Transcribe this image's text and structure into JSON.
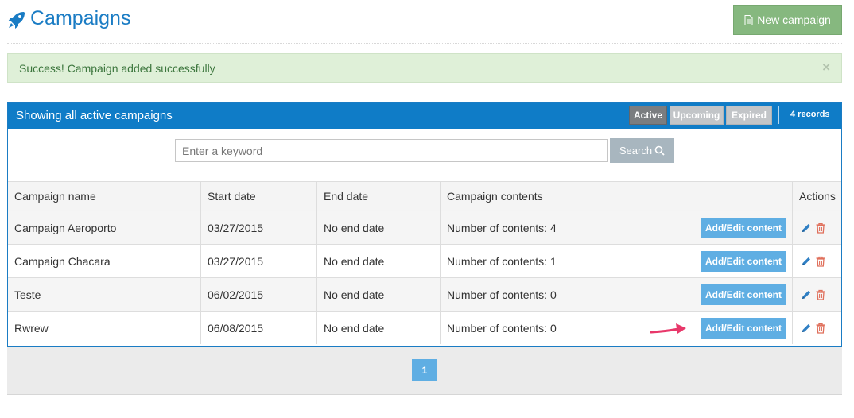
{
  "header": {
    "title": "Campaigns",
    "new_button_label": "New campaign"
  },
  "alert": {
    "message": "Success! Campaign added successfully",
    "close_symbol": "×"
  },
  "panel": {
    "title": "Showing all active campaigns",
    "filters": [
      "Active",
      "Upcoming",
      "Expired"
    ],
    "active_filter": "Active",
    "records": "4 records"
  },
  "search": {
    "placeholder": "Enter a keyword",
    "value": "",
    "button_label": "Search"
  },
  "table": {
    "columns": [
      "Campaign name",
      "Start date",
      "End date",
      "Campaign contents",
      "Actions"
    ],
    "add_button_label": "Add/Edit content",
    "rows": [
      {
        "name": "Campaign Aeroporto",
        "start": "03/27/2015",
        "end": "No end date",
        "contents": "Number of contents: 4"
      },
      {
        "name": "Campaign Chacara",
        "start": "03/27/2015",
        "end": "No end date",
        "contents": "Number of contents: 1"
      },
      {
        "name": "Teste",
        "start": "06/02/2015",
        "end": "No end date",
        "contents": "Number of contents: 0"
      },
      {
        "name": "Rwrew",
        "start": "06/08/2015",
        "end": "No end date",
        "contents": "Number of contents: 0"
      }
    ]
  },
  "pagination": {
    "current_page": "1"
  },
  "icons": {
    "title": "rocket-icon",
    "new_button": "document-icon",
    "search_button": "search-icon",
    "edit": "pencil-icon",
    "delete": "trash-icon",
    "annotation": "arrow-icon"
  },
  "colors": {
    "brand_blue": "#0f7cc7",
    "success_button": "#86b87f",
    "alert_background": "#dff0d8",
    "alert_text": "#3c763d",
    "action_button": "#5faee3",
    "delete_icon": "#e0705c",
    "annotation_arrow": "#e8386a"
  }
}
